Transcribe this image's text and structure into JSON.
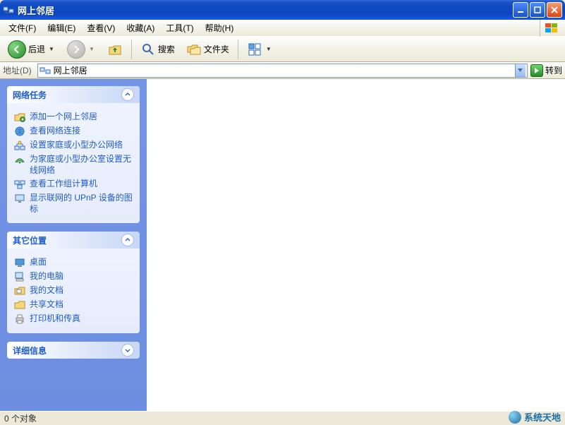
{
  "window": {
    "title": "网上邻居"
  },
  "menu": {
    "file": "文件(F)",
    "edit": "编辑(E)",
    "view": "查看(V)",
    "favorites": "收藏(A)",
    "tools": "工具(T)",
    "help": "帮助(H)"
  },
  "toolbar": {
    "back": "后退",
    "search": "搜索",
    "folders": "文件夹"
  },
  "address": {
    "label": "地址(D)",
    "value": "网上邻居",
    "go": "转到"
  },
  "sidebar": {
    "panel1": {
      "title": "网络任务",
      "items": [
        "添加一个网上邻居",
        "查看网络连接",
        "设置家庭或小型办公网络",
        "为家庭或小型办公室设置无线网络",
        "查看工作组计算机",
        "显示联网的 UPnP 设备的图标"
      ]
    },
    "panel2": {
      "title": "其它位置",
      "items": [
        "桌面",
        "我的电脑",
        "我的文档",
        "共享文档",
        "打印机和传真"
      ]
    },
    "panel3": {
      "title": "详细信息"
    }
  },
  "status": {
    "text": "0 个对象"
  },
  "watermark": "系统天地"
}
